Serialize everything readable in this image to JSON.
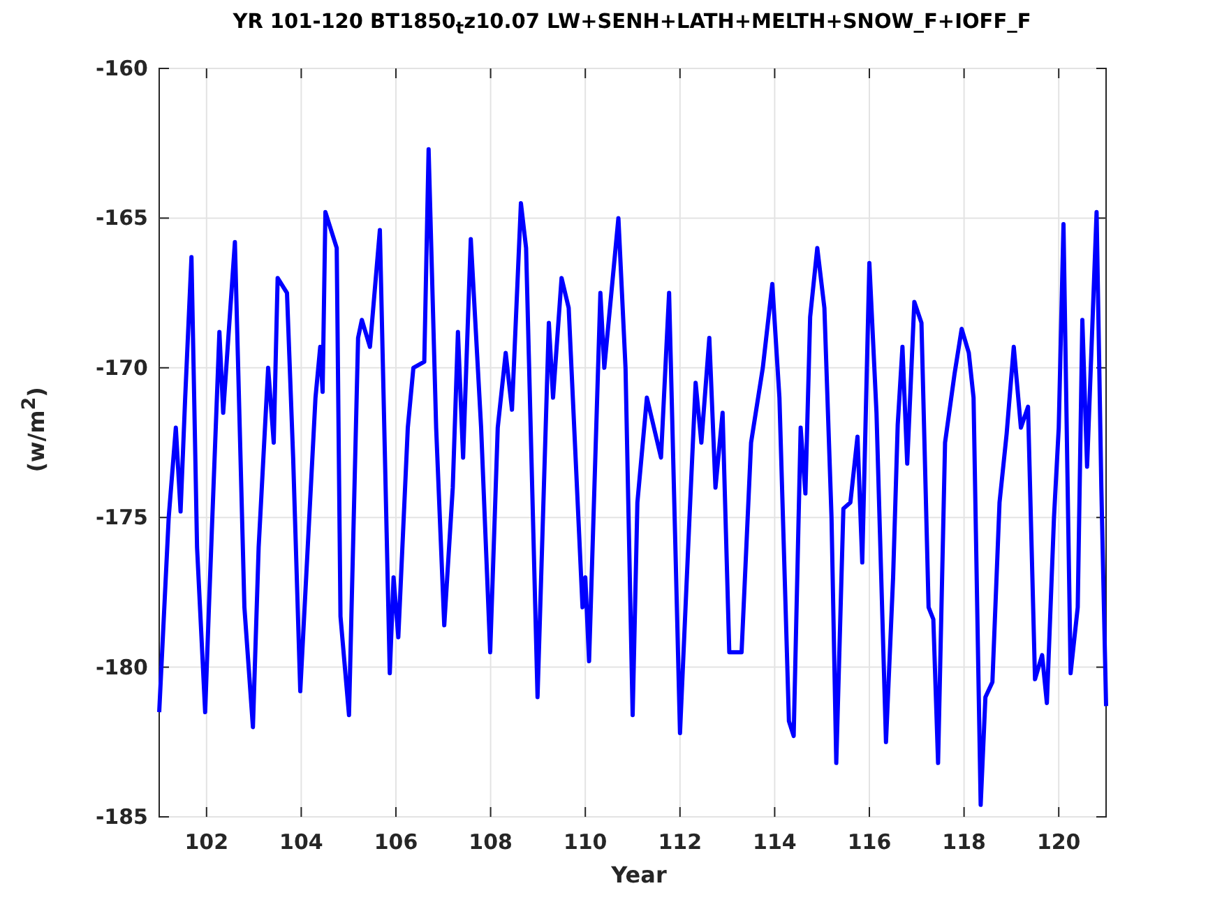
{
  "figure": {
    "chart_data": {
      "type": "line",
      "grid": true,
      "title": "YR 101-120 BT1850$_{t}$z10.07 LW+SENH+LATH+MELTH+SNOW_F+IOFF_F",
      "xlabel": "Year",
      "ylabel": "(w/m$^{2}$)",
      "xlim": [
        101,
        121
      ],
      "ylim": [
        -185,
        -160
      ],
      "xticks": [
        102,
        104,
        106,
        108,
        110,
        112,
        114,
        116,
        118,
        120
      ],
      "yticks": [
        -185,
        -180,
        -175,
        -170,
        -165,
        -160
      ],
      "x": [
        101.0,
        101.2,
        101.35,
        101.45,
        101.55,
        101.68,
        101.8,
        101.97,
        102.05,
        102.27,
        102.35,
        102.6,
        102.8,
        102.98,
        103.1,
        103.3,
        103.42,
        103.5,
        103.7,
        103.83,
        103.98,
        104.3,
        104.4,
        104.45,
        104.51,
        104.75,
        104.83,
        105.01,
        105.2,
        105.28,
        105.45,
        105.66,
        105.87,
        105.95,
        106.05,
        106.25,
        106.37,
        106.6,
        106.69,
        106.85,
        107.02,
        107.2,
        107.31,
        107.42,
        107.58,
        107.8,
        107.99,
        108.15,
        108.32,
        108.45,
        108.64,
        108.75,
        108.99,
        109.23,
        109.32,
        109.5,
        109.65,
        109.94,
        110.0,
        110.08,
        110.32,
        110.4,
        110.7,
        110.85,
        111.0,
        111.1,
        111.3,
        111.6,
        111.77,
        112.0,
        112.2,
        112.33,
        112.45,
        112.62,
        112.75,
        112.9,
        113.04,
        113.3,
        113.5,
        113.75,
        113.95,
        114.1,
        114.3,
        114.4,
        114.55,
        114.65,
        114.75,
        114.9,
        115.05,
        115.2,
        115.3,
        115.45,
        115.6,
        115.75,
        115.85,
        116.0,
        116.15,
        116.35,
        116.5,
        116.6,
        116.7,
        116.8,
        116.95,
        117.1,
        117.25,
        117.35,
        117.45,
        117.6,
        117.8,
        117.95,
        118.1,
        118.2,
        118.35,
        118.45,
        118.6,
        118.75,
        118.9,
        119.05,
        119.2,
        119.35,
        119.5,
        119.65,
        119.75,
        119.9,
        120.0,
        120.1,
        120.25,
        120.4,
        120.5,
        120.6,
        120.8,
        120.9,
        121.0
      ],
      "series": [
        {
          "color": "#0000ff",
          "values": [
            -181.5,
            -175,
            -172,
            -174.8,
            -171,
            -166.3,
            -176,
            -181.5,
            -178,
            -168.8,
            -171.5,
            -165.8,
            -178,
            -182,
            -176,
            -170,
            -172.5,
            -167,
            -167.5,
            -173,
            -180.8,
            -171,
            -169.3,
            -170.8,
            -164.8,
            -166,
            -178.3,
            -181.6,
            -169,
            -168.4,
            -169.3,
            -165.4,
            -180.2,
            -177,
            -179,
            -172,
            -170,
            -169.8,
            -162.7,
            -172,
            -178.6,
            -174,
            -168.8,
            -173,
            -165.7,
            -172,
            -179.5,
            -172,
            -169.5,
            -171.4,
            -164.5,
            -166,
            -181,
            -168.5,
            -171,
            -167,
            -168,
            -178,
            -177,
            -179.8,
            -167.5,
            -170,
            -165,
            -170,
            -181.6,
            -174.5,
            -171,
            -173,
            -167.5,
            -182.2,
            -175,
            -170.5,
            -172.5,
            -169,
            -174,
            -171.5,
            -179.5,
            -179.5,
            -172.5,
            -170,
            -167.2,
            -171,
            -181.8,
            -182.3,
            -172,
            -174.2,
            -168.3,
            -166,
            -168,
            -175,
            -183.2,
            -174.7,
            -174.5,
            -172.3,
            -176.5,
            -166.5,
            -171.5,
            -182.5,
            -177,
            -171.9,
            -169.3,
            -173.2,
            -167.8,
            -168.5,
            -178,
            -178.4,
            -183.2,
            -172.5,
            -170.2,
            -168.7,
            -169.5,
            -171,
            -184.6,
            -181,
            -180.5,
            -174.5,
            -172.2,
            -169.3,
            -172,
            -171.3,
            -180.4,
            -179.6,
            -181.2,
            -175,
            -172,
            -165.2,
            -180.2,
            -178,
            -168.4,
            -173.3,
            -164.8,
            -174,
            -181.3
          ]
        }
      ]
    }
  }
}
